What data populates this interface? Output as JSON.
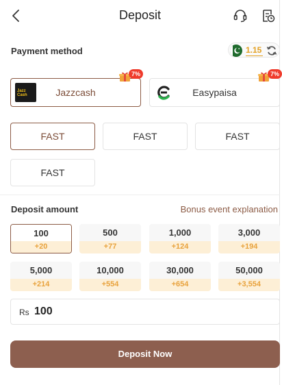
{
  "header": {
    "title": "Deposit"
  },
  "payment": {
    "label": "Payment method",
    "balance": "1.15",
    "methods": [
      {
        "name": "Jazzcash",
        "logo_text": "Jazz Cash",
        "promo": "7%"
      },
      {
        "name": "Easypaisa",
        "promo": "7%"
      }
    ]
  },
  "channels": [
    "FAST",
    "FAST",
    "FAST",
    "FAST"
  ],
  "deposit": {
    "label": "Deposit amount",
    "bonus_link": "Bonus event explanation",
    "amounts": [
      {
        "amount": "100",
        "bonus": "+20"
      },
      {
        "amount": "500",
        "bonus": "+77"
      },
      {
        "amount": "1,000",
        "bonus": "+124"
      },
      {
        "amount": "3,000",
        "bonus": "+194"
      },
      {
        "amount": "5,000",
        "bonus": "+214"
      },
      {
        "amount": "10,000",
        "bonus": "+554"
      },
      {
        "amount": "30,000",
        "bonus": "+654"
      },
      {
        "amount": "50,000",
        "bonus": "+3,554"
      }
    ],
    "currency": "Rs",
    "value": "100",
    "button": "Deposit Now"
  },
  "colors": {
    "accent": "#8b5a44",
    "bonus": "#e8a23c",
    "promo_badge": "#ef3b2c"
  }
}
